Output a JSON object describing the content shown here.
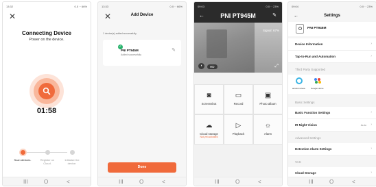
{
  "phone1": {
    "status_time": "13:32",
    "status_right": "0.0 ·· 66%",
    "title": "Connecting Device",
    "subtitle": "Power on the device.",
    "timer": "01:58",
    "steps": [
      {
        "label": "Scan devices."
      },
      {
        "label": "Register on Cloud."
      },
      {
        "label": "Initialize the device."
      }
    ]
  },
  "phone2": {
    "status_time": "13:33",
    "status_right": "0.0 ·· 66%",
    "title": "Add Device",
    "note": "1 device(s) added successfully",
    "device_name": "PNI PT945M",
    "device_status": "Added successfully",
    "done_label": "Done"
  },
  "phone3": {
    "status_time": "09:03",
    "status_right": "0.0 ·· 23%",
    "title": "PNI PT945M",
    "signal": "Signal: 67%",
    "hd_label": "HD",
    "cells": [
      {
        "label": "Screenshot",
        "sub": ""
      },
      {
        "label": "Record",
        "sub": ""
      },
      {
        "label": "Photo album",
        "sub": ""
      },
      {
        "label": "Cloud storage",
        "sub": "Not yet activated"
      },
      {
        "label": "Playback",
        "sub": ""
      },
      {
        "label": "Alarm",
        "sub": ""
      }
    ]
  },
  "phone4": {
    "status_time": "09:04",
    "status_right": "0.0 ·· 23%",
    "title": "Settings",
    "device_name": "PNI PT945M",
    "rows_a": [
      "Device Information",
      "Tap-to-Run and Automation"
    ],
    "section_third": "Third Party Supported",
    "alexa_label": "amazon alexa",
    "google_label": "Google Home",
    "section_basic": "Basic Settings",
    "row_basic": "Basic Function Settings",
    "row_ir": "IR Night Vision",
    "row_ir_value": "Auto",
    "section_adv": "Advanced Settings",
    "row_detect": "Detection Alarm Settings",
    "section_vas": "VAS",
    "row_cloud": "Cloud Storage"
  },
  "navbar": {
    "menu": "III",
    "home": "O",
    "back": "<"
  }
}
